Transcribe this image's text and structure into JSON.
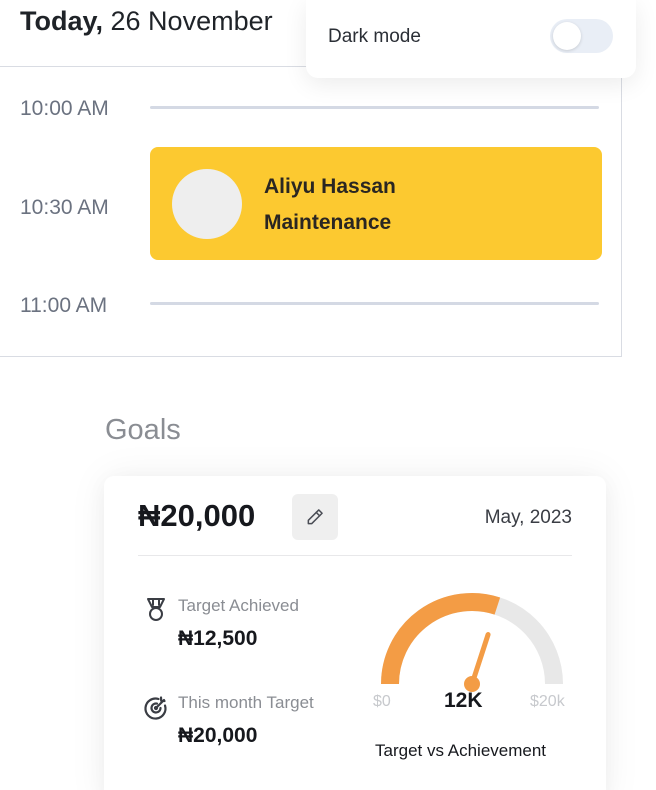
{
  "header": {
    "title_bold": "Today,",
    "title_rest": " 26 November"
  },
  "settings_popup": {
    "dark_mode_label": "Dark mode",
    "dark_mode_enabled": false
  },
  "schedule": {
    "times": [
      "10:00 AM",
      "10:30 AM",
      "11:00 AM"
    ],
    "appointment": {
      "name": "Aliyu Hassan",
      "type": "Maintenance",
      "color": "#fcc930"
    }
  },
  "goals": {
    "heading": "Goals",
    "amount": "₦20,000",
    "date": "May, 2023",
    "stats": [
      {
        "icon": "medal-icon",
        "label": "Target Achieved",
        "value": "₦12,500"
      },
      {
        "icon": "target-icon",
        "label": "This month Target",
        "value": "₦20,000"
      }
    ],
    "gauge": {
      "min_label": "$0",
      "max_label": "$20k",
      "value_label": "12K",
      "caption": "Target vs Achievement",
      "value": 12000,
      "max": 20000,
      "fill_color": "#f39c45",
      "track_color": "#e8e8e8"
    }
  }
}
